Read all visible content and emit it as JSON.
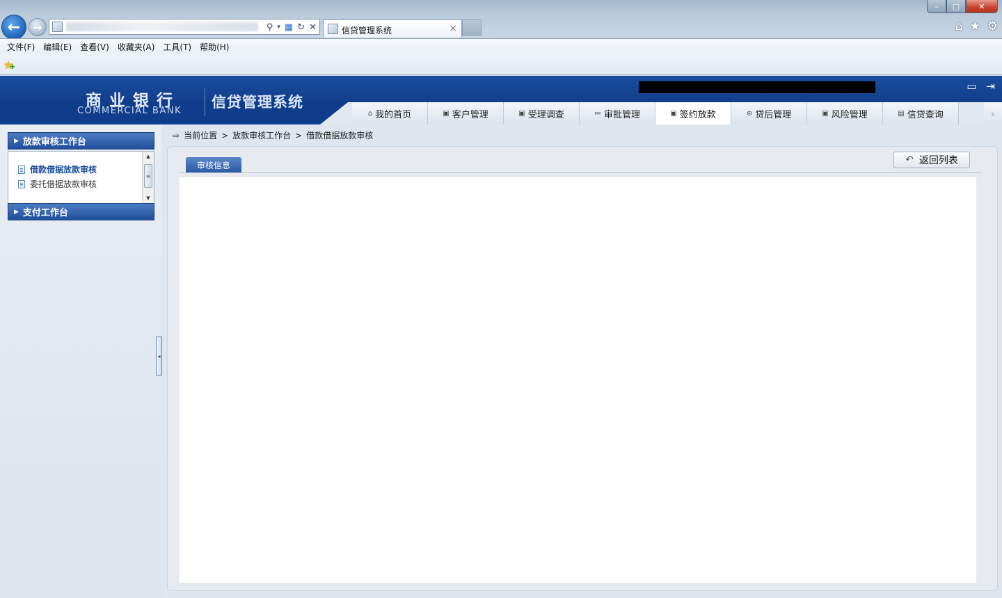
{
  "browser": {
    "tab_title": "信贷管理系统",
    "tab_close": "×",
    "back_glyph": "←",
    "forward_glyph": "→",
    "window_controls": {
      "minimize": "–",
      "maximize": "□",
      "close": "✕"
    },
    "right_icons": [
      "home-icon",
      "favorites-star-icon",
      "tools-gear-icon"
    ],
    "menu": [
      "文件(F)",
      "编辑(E)",
      "查看(V)",
      "收藏夹(A)",
      "工具(T)",
      "帮助(H)"
    ]
  },
  "header": {
    "logo_cn": "商业银行",
    "logo_en": "COMMERCIAL BANK",
    "system_title": "信贷管理系统",
    "icons": [
      "monitor-icon",
      "logout-icon"
    ],
    "tabs": [
      {
        "label": "我的首页",
        "icon": "⌂"
      },
      {
        "label": "客户管理",
        "icon": "▣"
      },
      {
        "label": "受理调查",
        "icon": "▣"
      },
      {
        "label": "审批管理",
        "icon": "≔"
      },
      {
        "label": "签约放款",
        "icon": "▣"
      },
      {
        "label": "贷后管理",
        "icon": "⊜"
      },
      {
        "label": "风险管理",
        "icon": "▣"
      },
      {
        "label": "信贷查询",
        "icon": "▤"
      }
    ],
    "active_tab": "签约放款",
    "more_arrow": "›"
  },
  "sidebar": {
    "panel1": {
      "title": "放款审核工作台",
      "items": [
        {
          "label": "借款借据放款审核",
          "active": true
        },
        {
          "label": "委托借据放款审核",
          "active": false
        }
      ]
    },
    "panel2": {
      "title": "支付工作台"
    },
    "collapse_glyph": "◂"
  },
  "breadcrumb": {
    "items": [
      "当前位置",
      "放款审核工作台",
      "借款借据放款审核"
    ],
    "separator": ">"
  },
  "main": {
    "sub_tab": "审核信息",
    "return_button": "返回列表"
  }
}
